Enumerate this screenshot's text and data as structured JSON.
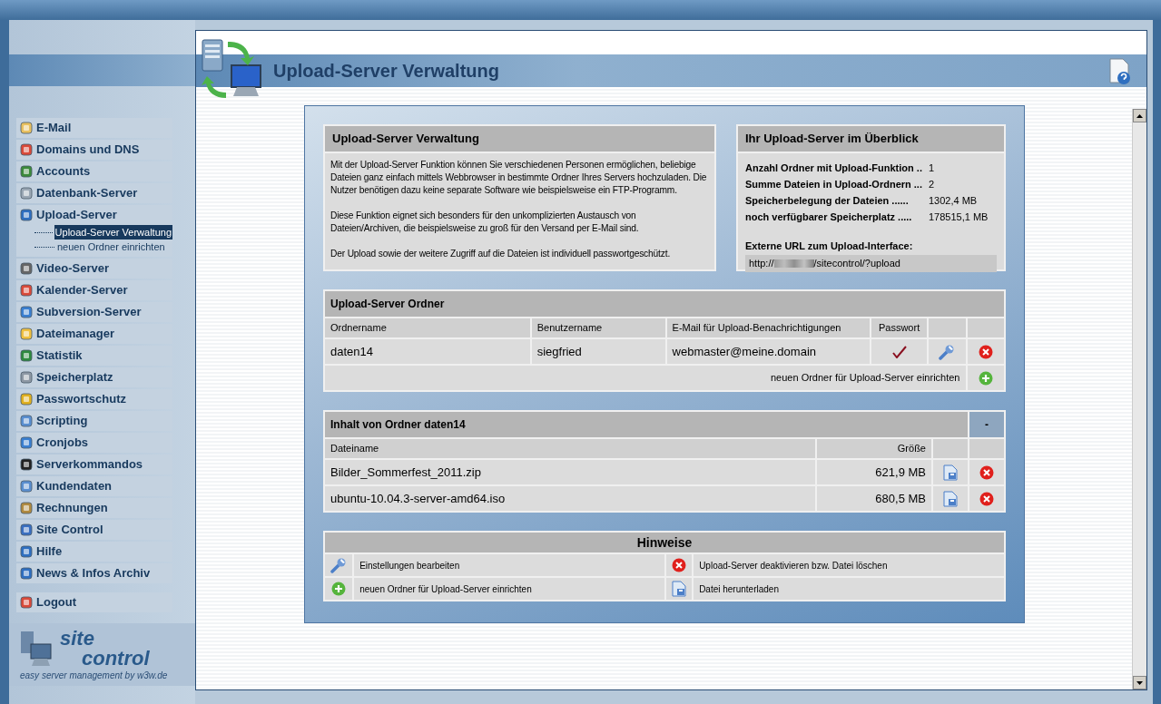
{
  "header": {
    "title": "Upload-Server Verwaltung"
  },
  "sidebar": {
    "items": [
      {
        "label": "E-Mail"
      },
      {
        "label": "Domains und DNS"
      },
      {
        "label": "Accounts"
      },
      {
        "label": "Datenbank-Server"
      },
      {
        "label": "Upload-Server",
        "children": [
          {
            "label": "Upload-Server Verwaltung",
            "selected": true
          },
          {
            "label": "neuen Ordner einrichten",
            "selected": false
          }
        ]
      },
      {
        "label": "Video-Server"
      },
      {
        "label": "Kalender-Server"
      },
      {
        "label": "Subversion-Server"
      },
      {
        "label": "Dateimanager"
      },
      {
        "label": "Statistik"
      },
      {
        "label": "Speicherplatz"
      },
      {
        "label": "Passwortschutz"
      },
      {
        "label": "Scripting"
      },
      {
        "label": "Cronjobs"
      },
      {
        "label": "Serverkommandos"
      },
      {
        "label": "Kundendaten"
      },
      {
        "label": "Rechnungen"
      },
      {
        "label": "Site Control"
      },
      {
        "label": "Hilfe"
      },
      {
        "label": "News & Infos Archiv"
      }
    ],
    "logout": "Logout",
    "logo": {
      "line1": "site",
      "line2": "control",
      "tagline": "easy server management by w3w.de"
    }
  },
  "intro": {
    "title": "Upload-Server Verwaltung",
    "paragraphs": [
      "Mit der Upload-Server Funktion können Sie verschiedenen Personen ermöglichen, beliebige Dateien ganz einfach mittels Webbrowser in bestimmte Ordner Ihres Servers hochzuladen. Die Nutzer benötigen dazu keine separate Software wie beispielsweise ein FTP-Programm.",
      "Diese Funktion eignet sich besonders für den unkomplizierten Austausch von Dateien/Archiven, die beispielsweise zu groß für den Versand per E-Mail sind.",
      "Der Upload sowie der weitere Zugriff auf die Dateien ist individuell passwortgeschützt."
    ]
  },
  "overview": {
    "title": "Ihr Upload-Server im Überblick",
    "stats": [
      {
        "label": "Anzahl Ordner mit Upload-Funktion ..",
        "value": "1"
      },
      {
        "label": "Summe Dateien in Upload-Ordnern ...",
        "value": "2"
      },
      {
        "label": "Speicherbelegung der Dateien ......",
        "value": "1302,4 MB"
      },
      {
        "label": "noch verfügbarer Speicherplatz .....",
        "value": "178515,1 MB"
      }
    ],
    "url_label": "Externe URL zum Upload-Interface:",
    "url_prefix": "http://",
    "url_suffix": "/sitecontrol/?upload"
  },
  "folders": {
    "title": "Upload-Server Ordner",
    "columns": [
      "Ordnername",
      "Benutzername",
      "E-Mail für Upload-Benachrichtigungen",
      "Passwort"
    ],
    "rows": [
      {
        "name": "daten14",
        "user": "siegfried",
        "email": "webmaster@meine.domain",
        "password": true
      }
    ],
    "add_label": "neuen Ordner für Upload-Server einrichten"
  },
  "contents": {
    "title": "Inhalt von Ordner daten14",
    "collapse": "-",
    "columns": [
      "Dateiname",
      "Größe"
    ],
    "rows": [
      {
        "name": "Bilder_Sommerfest_2011.zip",
        "size": "621,9 MB"
      },
      {
        "name": "ubuntu-10.04.3-server-amd64.iso",
        "size": "680,5 MB"
      }
    ]
  },
  "hints": {
    "title": "Hinweise",
    "items": [
      {
        "kind": "edit",
        "text": "Einstellungen bearbeiten"
      },
      {
        "kind": "delete",
        "text": "Upload-Server deaktivieren bzw. Datei löschen"
      },
      {
        "kind": "add",
        "text": "neuen Ordner für Upload-Server einrichten"
      },
      {
        "kind": "download",
        "text": "Datei herunterladen"
      }
    ]
  }
}
